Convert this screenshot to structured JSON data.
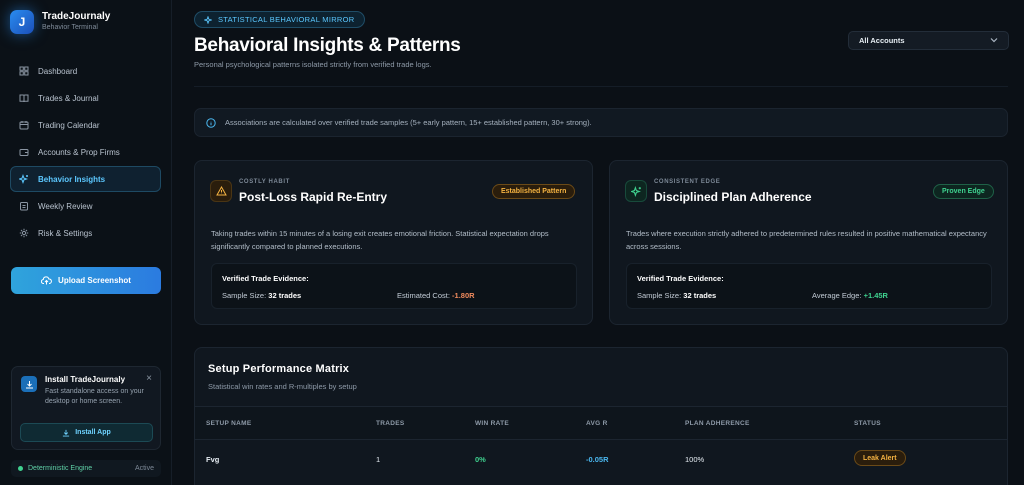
{
  "brand": {
    "name": "TradeJournaly",
    "subtitle": "Behavior Terminal",
    "logo_letter": "J"
  },
  "sidebar": {
    "items": [
      {
        "label": "Dashboard",
        "icon": "grid-icon"
      },
      {
        "label": "Trades & Journal",
        "icon": "book-icon"
      },
      {
        "label": "Trading Calendar",
        "icon": "calendar-icon"
      },
      {
        "label": "Accounts & Prop Firms",
        "icon": "wallet-icon"
      },
      {
        "label": "Behavior Insights",
        "icon": "sparkle-icon",
        "active": true
      },
      {
        "label": "Weekly Review",
        "icon": "clipboard-icon"
      },
      {
        "label": "Risk & Settings",
        "icon": "gear-icon"
      }
    ],
    "upload_label": "Upload Screenshot",
    "install": {
      "title": "Install TradeJournaly",
      "description": "Fast standalone access on your desktop or home screen.",
      "button_label": "Install App",
      "close_glyph": "×"
    },
    "engine": {
      "label": "Deterministic Engine",
      "status": "Active"
    }
  },
  "header": {
    "badge": "STATISTICAL BEHAVIORAL MIRROR",
    "title": "Behavioral Insights & Patterns",
    "subtitle": "Personal psychological patterns isolated strictly from verified trade logs.",
    "account_select": "All Accounts"
  },
  "info": "Associations are calculated over verified trade samples (5+ early pattern, 15+ established pattern, 30+ strong).",
  "cards": [
    {
      "kicker": "COSTLY HABIT",
      "title": "Post-Loss Rapid Re-Entry",
      "tag": "Established Pattern",
      "description": "Taking trades within 15 minutes of a losing exit creates emotional friction. Statistical expectation drops significantly compared to planned executions.",
      "evidence_title": "Verified Trade Evidence:",
      "sample_label": "Sample Size:",
      "sample_value": "32 trades",
      "metric_label": "Estimated Cost:",
      "metric_value": "-1.80R",
      "colors": {
        "tag_text": "#f5b342",
        "metric": "#f08a5d"
      }
    },
    {
      "kicker": "CONSISTENT EDGE",
      "title": "Disciplined Plan Adherence",
      "tag": "Proven Edge",
      "description": "Trades where execution strictly adhered to predetermined rules resulted in positive mathematical expectancy across sessions.",
      "evidence_title": "Verified Trade Evidence:",
      "sample_label": "Sample Size:",
      "sample_value": "32 trades",
      "metric_label": "Average Edge:",
      "metric_value": "+1.45R",
      "colors": {
        "tag_text": "#3fd18f",
        "metric": "#3fd18f"
      }
    }
  ],
  "matrix": {
    "title": "Setup Performance Matrix",
    "subtitle": "Statistical win rates and R-multiples by setup",
    "columns": [
      "SETUP NAME",
      "TRADES",
      "WIN RATE",
      "AVG R",
      "PLAN ADHERENCE",
      "STATUS"
    ],
    "rows": [
      {
        "setup": "Fvg",
        "trades": "1",
        "win_rate": "0%",
        "avg_r": "-0.05R",
        "adherence": "100%",
        "status": "Leak Alert"
      }
    ]
  }
}
